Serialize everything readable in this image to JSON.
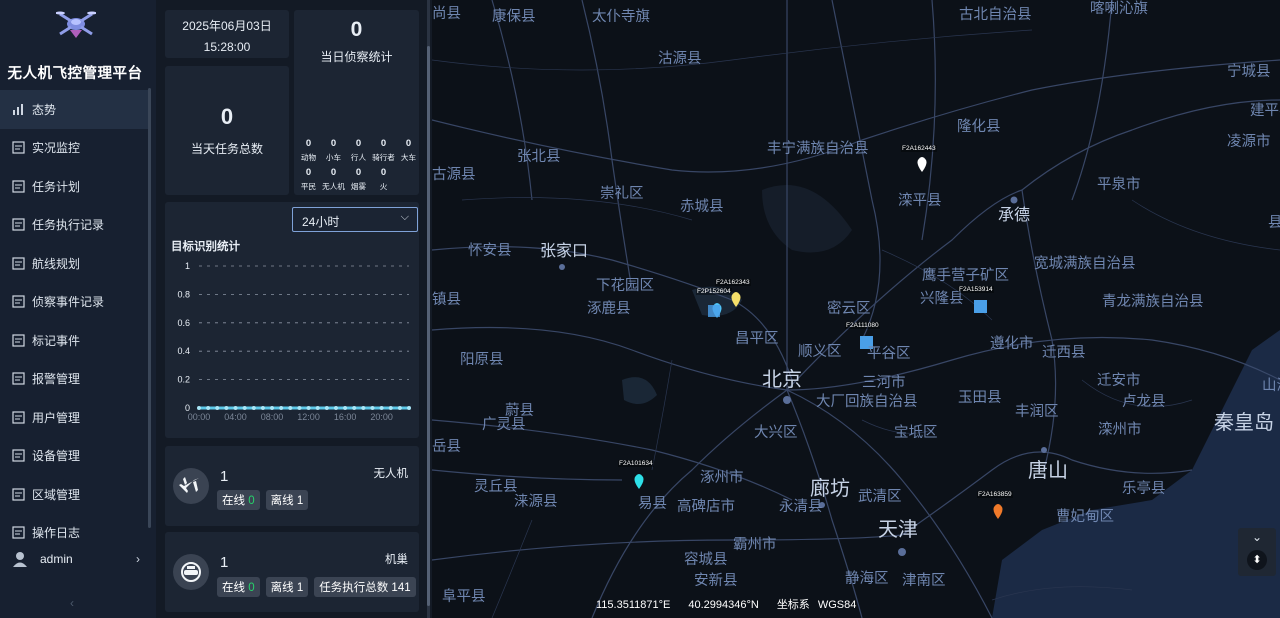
{
  "app": {
    "title": "无人机飞控管理平台"
  },
  "sidebar": {
    "items": [
      {
        "label": "态势",
        "icon": "chart-icon",
        "active": true
      },
      {
        "label": "实况监控",
        "icon": "monitor-icon"
      },
      {
        "label": "任务计划",
        "icon": "task-plan-icon"
      },
      {
        "label": "任务执行记录",
        "icon": "record-icon"
      },
      {
        "label": "航线规划",
        "icon": "route-icon"
      },
      {
        "label": "侦察事件记录",
        "icon": "event-icon"
      },
      {
        "label": "标记事件",
        "icon": "mark-icon"
      },
      {
        "label": "报警管理",
        "icon": "alarm-icon"
      },
      {
        "label": "用户管理",
        "icon": "user-icon"
      },
      {
        "label": "设备管理",
        "icon": "device-icon"
      },
      {
        "label": "区域管理",
        "icon": "area-icon"
      },
      {
        "label": "操作日志",
        "icon": "log-icon"
      }
    ],
    "user": "admin",
    "collapse_glyph": "‹"
  },
  "datetime": {
    "date": "2025年06月03日",
    "time": "15:28:00"
  },
  "stats": {
    "daily_recon_count": "0",
    "daily_recon_label": "当日侦察统计",
    "daily_task_count": "0",
    "daily_task_label": "当天任务总数",
    "categories": [
      {
        "label": "动物",
        "value": "0"
      },
      {
        "label": "小车",
        "value": "0"
      },
      {
        "label": "行人",
        "value": "0"
      },
      {
        "label": "骑行者",
        "value": "0"
      },
      {
        "label": "大车",
        "value": "0"
      },
      {
        "label": "平民",
        "value": "0"
      },
      {
        "label": "无人机",
        "value": "0"
      },
      {
        "label": "烟雾",
        "value": "0"
      },
      {
        "label": "火",
        "value": "0"
      }
    ]
  },
  "target_chart": {
    "select_value": "24小时",
    "title": "目标识别统计"
  },
  "chart_data": {
    "type": "line",
    "title": "目标识别统计",
    "xlabel": "",
    "ylabel": "",
    "ylim": [
      0,
      1
    ],
    "yticks": [
      "1",
      "0.8",
      "0.6",
      "0.4",
      "0.2",
      "0"
    ],
    "xticks": [
      "00:00",
      "04:00",
      "08:00",
      "12:00",
      "16:00",
      "20:00"
    ],
    "x": [
      "00:00",
      "01:00",
      "02:00",
      "03:00",
      "04:00",
      "05:00",
      "06:00",
      "07:00",
      "08:00",
      "09:00",
      "10:00",
      "11:00",
      "12:00",
      "13:00",
      "14:00",
      "15:00",
      "16:00",
      "17:00",
      "18:00",
      "19:00",
      "20:00",
      "21:00",
      "22:00",
      "23:00"
    ],
    "series": [
      {
        "values": [
          0,
          0,
          0,
          0,
          0,
          0,
          0,
          0,
          0,
          0,
          0,
          0,
          0,
          0,
          0,
          0,
          0,
          0,
          0,
          0,
          0,
          0,
          0,
          0
        ]
      }
    ],
    "color": "#5bc8e8"
  },
  "drone_card": {
    "count": "1",
    "label": "无人机",
    "online_label": "在线",
    "online": "0",
    "offline_label": "离线",
    "offline": "1"
  },
  "dock_card": {
    "count": "1",
    "label": "机巢",
    "online_label": "在线",
    "online": "0",
    "offline_label": "离线",
    "offline": "1",
    "tasks_label": "任务执行总数",
    "tasks": "141"
  },
  "map": {
    "labels": [
      {
        "t": "康保县"
      },
      {
        "t": "太仆寺旗"
      },
      {
        "t": "古北自治县"
      },
      {
        "t": "喀喇沁旗"
      },
      {
        "t": "沽源县"
      },
      {
        "t": "宁城县"
      },
      {
        "t": "隆化县"
      },
      {
        "t": "建平县"
      },
      {
        "t": "丰宁满族自治县"
      },
      {
        "t": "张北县"
      },
      {
        "t": "凌源市"
      },
      {
        "t": "崇礼区"
      },
      {
        "t": "平泉市"
      },
      {
        "t": "赤城县"
      },
      {
        "t": "滦平县"
      },
      {
        "t": "承德"
      },
      {
        "t": "怀安县"
      },
      {
        "t": "张家口"
      },
      {
        "t": "鹰手营子矿区"
      },
      {
        "t": "宽城满族自治县"
      },
      {
        "t": "下花园区"
      },
      {
        "t": "兴隆县"
      },
      {
        "t": "青龙满族自治县"
      },
      {
        "t": "涿鹿县"
      },
      {
        "t": "密云区"
      },
      {
        "t": "昌平区"
      },
      {
        "t": "遵化市"
      },
      {
        "t": "迁西县"
      },
      {
        "t": "阳原县"
      },
      {
        "t": "顺义区"
      },
      {
        "t": "平谷区"
      },
      {
        "t": "北京"
      },
      {
        "t": "三河市"
      },
      {
        "t": "迁安市"
      },
      {
        "t": "大厂回族自治县"
      },
      {
        "t": "玉田县"
      },
      {
        "t": "卢龙县"
      },
      {
        "t": "蔚县"
      },
      {
        "t": "丰润区"
      },
      {
        "t": "广灵县"
      },
      {
        "t": "大兴区"
      },
      {
        "t": "宝坻区"
      },
      {
        "t": "滦州市"
      },
      {
        "t": "秦皇岛"
      },
      {
        "t": "灵丘县"
      },
      {
        "t": "涿州市"
      },
      {
        "t": "唐山"
      },
      {
        "t": "廊坊"
      },
      {
        "t": "涞源县"
      },
      {
        "t": "易县"
      },
      {
        "t": "高碑店市"
      },
      {
        "t": "永清县"
      },
      {
        "t": "武清区"
      },
      {
        "t": "乐亭县"
      },
      {
        "t": "曹妃甸区"
      },
      {
        "t": "天津"
      },
      {
        "t": "霸州市"
      },
      {
        "t": "容城县"
      },
      {
        "t": "安新县"
      },
      {
        "t": "静海区"
      },
      {
        "t": "津南区"
      },
      {
        "t": "阜平县"
      },
      {
        "t": "镇县"
      },
      {
        "t": "山海"
      },
      {
        "t": "古源县"
      },
      {
        "t": "尚县"
      },
      {
        "t": "县"
      },
      {
        "t": "岳县"
      }
    ],
    "markers": [
      {
        "label": "F2A162443",
        "color": "#ffffff",
        "type": "pin"
      },
      {
        "label": "F2A162343",
        "color": "#f5e06a",
        "type": "pin"
      },
      {
        "label": "F2P152604",
        "color": "#4fc3f7",
        "type": "pin"
      },
      {
        "label": "F2A153914",
        "color": "#4a9fe8",
        "type": "square"
      },
      {
        "label": "F2A111080",
        "color": "#4a9fe8",
        "type": "square"
      },
      {
        "label": "F2A101634",
        "color": "#2ee0e8",
        "type": "pin"
      },
      {
        "label": "F2A163859",
        "color": "#f07a2a",
        "type": "pin"
      }
    ],
    "coords": {
      "lon": "115.3511871°E",
      "lat": "40.2994346°N",
      "crs_label": "坐标系",
      "crs": "WGS84"
    }
  }
}
